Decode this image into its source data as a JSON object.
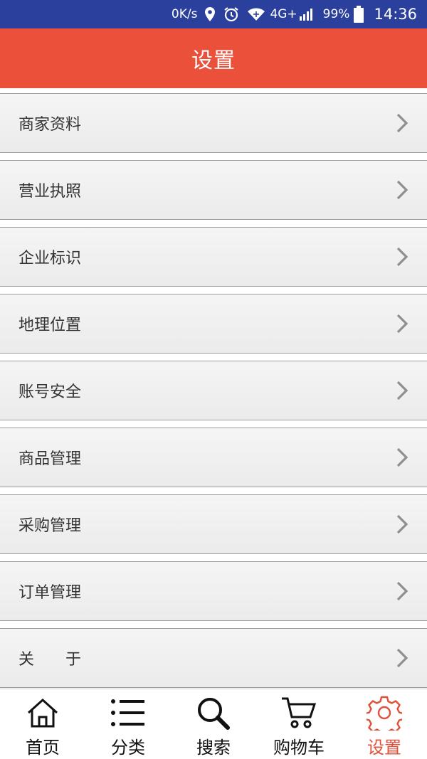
{
  "status_bar": {
    "speed": "0K/s",
    "network": "4G+",
    "battery": "99%",
    "time": "14:36",
    "icons": [
      "location-icon",
      "alarm-icon",
      "wifi-icon",
      "signal-icon",
      "battery-icon"
    ]
  },
  "header": {
    "title": "设置"
  },
  "settings": {
    "items": [
      {
        "label": "商家资料"
      },
      {
        "label": "营业执照"
      },
      {
        "label": "企业标识"
      },
      {
        "label": "地理位置"
      },
      {
        "label": "账号安全"
      },
      {
        "label": "商品管理"
      },
      {
        "label": "采购管理"
      },
      {
        "label": "订单管理"
      },
      {
        "label": "关于"
      }
    ]
  },
  "tabs": [
    {
      "label": "首页",
      "icon": "home-icon"
    },
    {
      "label": "分类",
      "icon": "list-icon"
    },
    {
      "label": "搜索",
      "icon": "search-icon"
    },
    {
      "label": "购物车",
      "icon": "cart-icon"
    },
    {
      "label": "设置",
      "icon": "gear-icon",
      "active": true
    }
  ],
  "colors": {
    "status_bar": "#2b3f9c",
    "header": "#eb503b",
    "active_tab": "#e0513a",
    "row_border": "#9c9c9c"
  }
}
